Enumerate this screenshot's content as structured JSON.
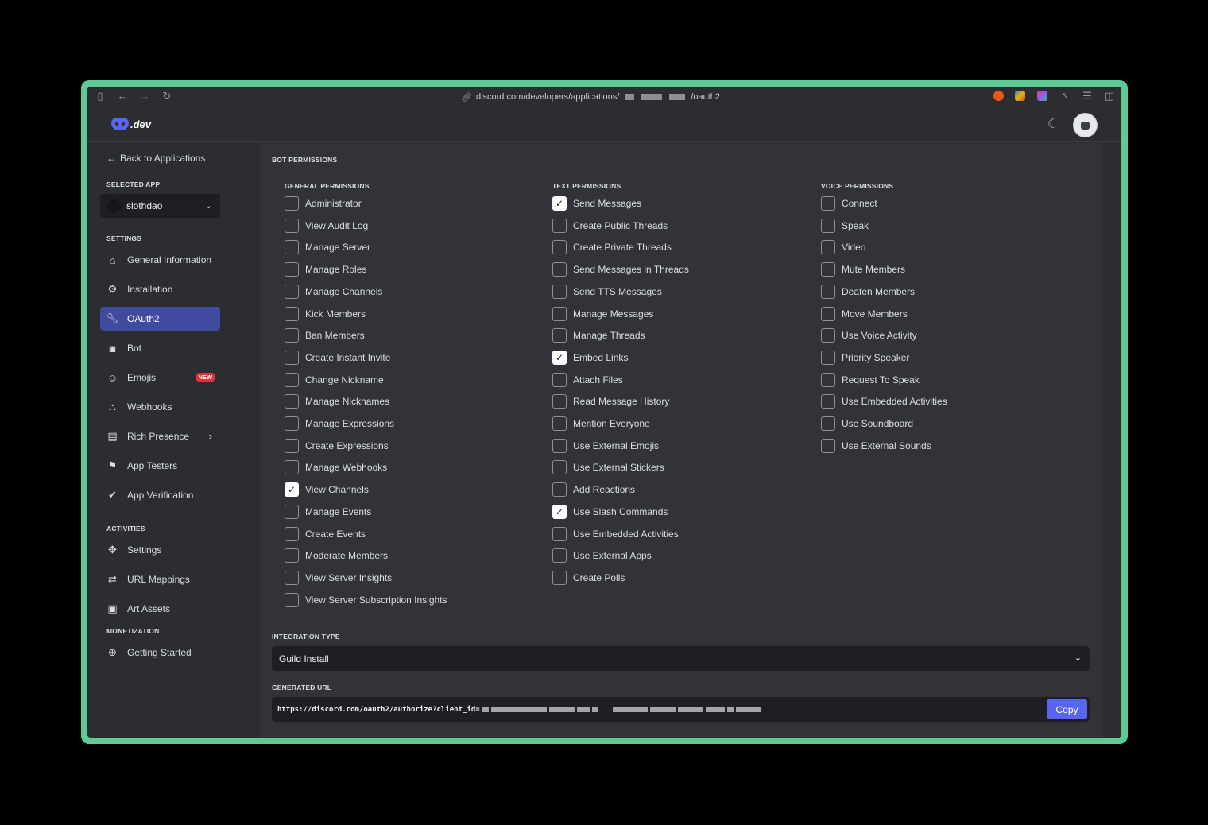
{
  "browser": {
    "url_prefix": "discord.com/developers/applications/",
    "url_suffix": "/oauth2"
  },
  "appbar": {
    "logo_text": ".dev"
  },
  "sidebar": {
    "back_label": "Back to Applications",
    "selected_app_title": "SELECTED APP",
    "selected_app": "slothdao",
    "settings_title": "SETTINGS",
    "settings_items": [
      {
        "label": "General Information",
        "icon": "home-icon"
      },
      {
        "label": "Installation",
        "icon": "gear-icon"
      },
      {
        "label": "OAuth2",
        "icon": "wrench-icon",
        "active": true
      },
      {
        "label": "Bot",
        "icon": "bot-icon"
      },
      {
        "label": "Emojis",
        "icon": "emoji-icon",
        "badge": "NEW"
      },
      {
        "label": "Webhooks",
        "icon": "webhook-icon"
      },
      {
        "label": "Rich Presence",
        "icon": "document-icon",
        "expandable": true
      },
      {
        "label": "App Testers",
        "icon": "testers-icon"
      },
      {
        "label": "App Verification",
        "icon": "clipboard-check-icon"
      }
    ],
    "activities_title": "ACTIVITIES",
    "activities_items": [
      {
        "label": "Settings",
        "icon": "activity-icon"
      },
      {
        "label": "URL Mappings",
        "icon": "url-mapping-icon"
      },
      {
        "label": "Art Assets",
        "icon": "image-icon"
      }
    ],
    "monetization_title": "MONETIZATION",
    "monetization_items": [
      {
        "label": "Getting Started",
        "icon": "plus-circle-icon"
      }
    ]
  },
  "main": {
    "bot_permissions_title": "BOT PERMISSIONS",
    "general": {
      "title": "GENERAL PERMISSIONS",
      "items": [
        {
          "label": "Administrator",
          "checked": false
        },
        {
          "label": "View Audit Log",
          "checked": false
        },
        {
          "label": "Manage Server",
          "checked": false
        },
        {
          "label": "Manage Roles",
          "checked": false
        },
        {
          "label": "Manage Channels",
          "checked": false
        },
        {
          "label": "Kick Members",
          "checked": false
        },
        {
          "label": "Ban Members",
          "checked": false
        },
        {
          "label": "Create Instant Invite",
          "checked": false
        },
        {
          "label": "Change Nickname",
          "checked": false
        },
        {
          "label": "Manage Nicknames",
          "checked": false
        },
        {
          "label": "Manage Expressions",
          "checked": false
        },
        {
          "label": "Create Expressions",
          "checked": false
        },
        {
          "label": "Manage Webhooks",
          "checked": false
        },
        {
          "label": "View Channels",
          "checked": true
        },
        {
          "label": "Manage Events",
          "checked": false
        },
        {
          "label": "Create Events",
          "checked": false
        },
        {
          "label": "Moderate Members",
          "checked": false
        },
        {
          "label": "View Server Insights",
          "checked": false
        },
        {
          "label": "View Server Subscription Insights",
          "checked": false
        }
      ]
    },
    "text": {
      "title": "TEXT PERMISSIONS",
      "items": [
        {
          "label": "Send Messages",
          "checked": true
        },
        {
          "label": "Create Public Threads",
          "checked": false
        },
        {
          "label": "Create Private Threads",
          "checked": false
        },
        {
          "label": "Send Messages in Threads",
          "checked": false
        },
        {
          "label": "Send TTS Messages",
          "checked": false
        },
        {
          "label": "Manage Messages",
          "checked": false
        },
        {
          "label": "Manage Threads",
          "checked": false
        },
        {
          "label": "Embed Links",
          "checked": true
        },
        {
          "label": "Attach Files",
          "checked": false
        },
        {
          "label": "Read Message History",
          "checked": false
        },
        {
          "label": "Mention Everyone",
          "checked": false
        },
        {
          "label": "Use External Emojis",
          "checked": false
        },
        {
          "label": "Use External Stickers",
          "checked": false
        },
        {
          "label": "Add Reactions",
          "checked": false
        },
        {
          "label": "Use Slash Commands",
          "checked": true
        },
        {
          "label": "Use Embedded Activities",
          "checked": false
        },
        {
          "label": "Use External Apps",
          "checked": false
        },
        {
          "label": "Create Polls",
          "checked": false
        }
      ]
    },
    "voice": {
      "title": "VOICE PERMISSIONS",
      "items": [
        {
          "label": "Connect",
          "checked": false
        },
        {
          "label": "Speak",
          "checked": false
        },
        {
          "label": "Video",
          "checked": false
        },
        {
          "label": "Mute Members",
          "checked": false
        },
        {
          "label": "Deafen Members",
          "checked": false
        },
        {
          "label": "Move Members",
          "checked": false
        },
        {
          "label": "Use Voice Activity",
          "checked": false
        },
        {
          "label": "Priority Speaker",
          "checked": false
        },
        {
          "label": "Request To Speak",
          "checked": false
        },
        {
          "label": "Use Embedded Activities",
          "checked": false
        },
        {
          "label": "Use Soundboard",
          "checked": false
        },
        {
          "label": "Use External Sounds",
          "checked": false
        }
      ]
    },
    "integration_type_title": "INTEGRATION TYPE",
    "integration_type_value": "Guild Install",
    "generated_url_title": "GENERATED URL",
    "generated_url_prefix": "https://discord.com/oauth2/authorize?client_id=",
    "copy_label": "Copy"
  },
  "colors": {
    "accent": "#5865f2",
    "frame": "#5ecb94",
    "active_nav": "#404ba0",
    "badge": "#da373c"
  }
}
